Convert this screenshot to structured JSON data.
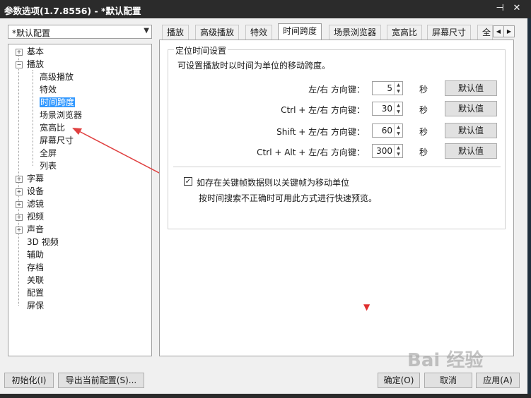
{
  "window": {
    "title": "参数选项(1.7.8556) - *默认配置",
    "pin_glyph": "⊣",
    "close_glyph": "✕"
  },
  "profile_select": {
    "value": "*默认配置"
  },
  "tree": {
    "items": [
      {
        "label": "基本",
        "expander": "+"
      },
      {
        "label": "播放",
        "expander": "−"
      },
      {
        "label": "高级播放"
      },
      {
        "label": "特效"
      },
      {
        "label": "时间跨度",
        "selected": true
      },
      {
        "label": "场景浏览器"
      },
      {
        "label": "宽高比"
      },
      {
        "label": "屏幕尺寸"
      },
      {
        "label": "全屏"
      },
      {
        "label": "列表"
      },
      {
        "label": "字幕",
        "expander": "+"
      },
      {
        "label": "设备",
        "expander": "+"
      },
      {
        "label": "滤镜",
        "expander": "+"
      },
      {
        "label": "视频",
        "expander": "+"
      },
      {
        "label": "声音",
        "expander": "+"
      },
      {
        "label": "3D 视频"
      },
      {
        "label": "辅助"
      },
      {
        "label": "存档"
      },
      {
        "label": "关联"
      },
      {
        "label": "配置"
      },
      {
        "label": "屏保"
      }
    ]
  },
  "tabs": [
    "播放",
    "高级播放",
    "特效",
    "时间跨度",
    "场景浏览器",
    "宽高比",
    "屏幕尺寸",
    "全"
  ],
  "tab_active": "时间跨度",
  "group": {
    "title": "定位时间设置",
    "description": "可设置播放时以时间为单位的移动跨度。",
    "rows": [
      {
        "label": "左/右 方向键：",
        "value": "5",
        "unit": "秒",
        "default_label": "默认值"
      },
      {
        "label": "Ctrl + 左/右 方向键：",
        "value": "30",
        "unit": "秒",
        "default_label": "默认值"
      },
      {
        "label": "Shift + 左/右 方向键：",
        "value": "60",
        "unit": "秒",
        "default_label": "默认值"
      },
      {
        "label": "Ctrl + Alt + 左/右 方向键：",
        "value": "300",
        "unit": "秒",
        "default_label": "默认值"
      }
    ],
    "checkbox_label": "如存在关键帧数据则以关键帧为移动单位",
    "checkbox_checked": true,
    "hint": "按时间搜索不正确时可用此方式进行快速预览。"
  },
  "footer": {
    "init": "初始化(I)",
    "export": "导出当前配置(S)...",
    "ok": "确定(O)",
    "cancel": "取消",
    "apply": "应用(A)"
  },
  "watermark": "Bai 经验"
}
